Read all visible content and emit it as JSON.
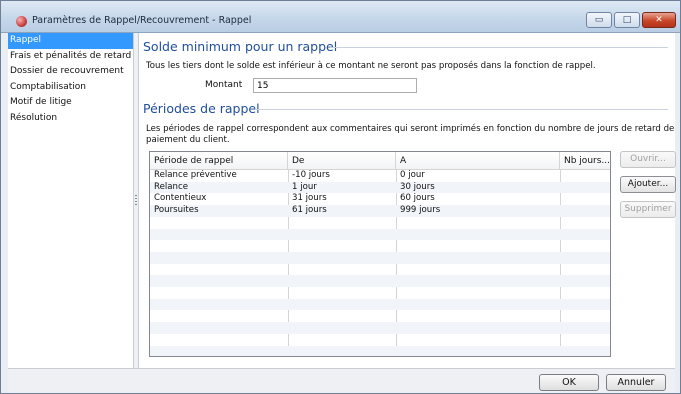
{
  "window": {
    "title": "Paramètres de Rappel/Recouvrement - Rappel",
    "controls": {
      "minimize": "▭",
      "maximize": "□",
      "close": "✕"
    }
  },
  "sidebar": {
    "items": [
      {
        "label": "Rappel",
        "selected": true
      },
      {
        "label": "Frais et pénalités de retard",
        "selected": false
      },
      {
        "label": "Dossier de recouvrement",
        "selected": false
      },
      {
        "label": "Comptabilisation",
        "selected": false
      },
      {
        "label": "Motif de litige",
        "selected": false
      },
      {
        "label": "Résolution",
        "selected": false
      }
    ]
  },
  "solde": {
    "title": "Solde minimum pour un rappel",
    "description": "Tous les tiers dont le solde est inférieur à ce montant ne seront pas proposés dans la fonction de rappel.",
    "montant_label": "Montant",
    "montant_value": "15"
  },
  "periodes": {
    "title": "Périodes de rappel",
    "description_line1": "Les périodes de rappel correspondent aux commentaires qui seront imprimés en fonction du nombre de jours de retard de",
    "description_line2": "paiement du client.",
    "columns": [
      "Période de rappel",
      "De",
      "A",
      "Nb jours..."
    ],
    "rows": [
      [
        "Relance préventive",
        "-10 jours",
        "0 jour",
        ""
      ],
      [
        "Relance",
        "1 jour",
        "30 jours",
        ""
      ],
      [
        "Contentieux",
        "31 jours",
        "60 jours",
        ""
      ],
      [
        "Poursuites",
        "61 jours",
        "999 jours",
        ""
      ]
    ],
    "buttons": {
      "open": "Ouvrir...",
      "add": "Ajouter...",
      "delete": "Supprimer"
    }
  },
  "footer": {
    "ok": "OK",
    "cancel": "Annuler"
  },
  "colors": {
    "selection": "#3399ff",
    "section_title": "#1f4e9c",
    "close_button": "#c9462a"
  }
}
